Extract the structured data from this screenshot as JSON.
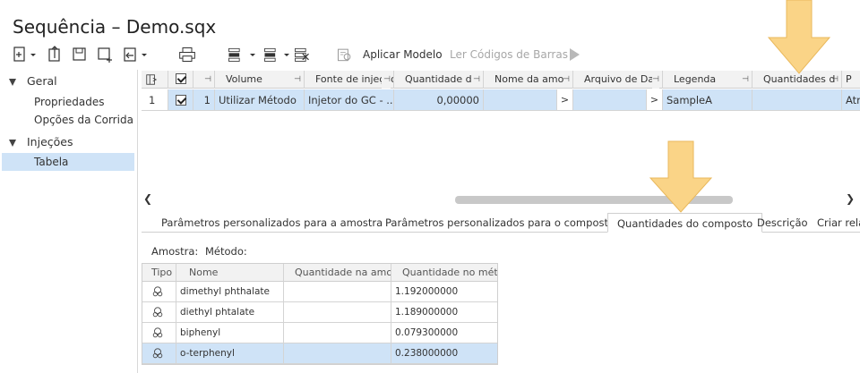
{
  "window": {
    "title": "Sequência – Demo.sqx"
  },
  "toolbar": {
    "apply_model": "Aplicar Modelo",
    "read_barcodes": "Ler Códigos de Barras"
  },
  "nav": {
    "groups": [
      {
        "label": "Geral",
        "items": [
          "Propriedades",
          "Opções da Corrida"
        ]
      },
      {
        "label": "Injeções",
        "items": [
          "Tabela"
        ]
      }
    ]
  },
  "grid": {
    "columns": [
      "",
      "",
      "",
      "Volume",
      "Fonte de injeção",
      "Quantidade d",
      "Nome da amo",
      "Arquivo de Da",
      "Legenda",
      "Quantidades d",
      "P"
    ],
    "row": {
      "index": "1",
      "num": "1",
      "volume": "Utilizar Método",
      "fonte": "Injetor do GC - ...",
      "quantidade": "0,00000",
      "nome_btn": ">",
      "arquivo_btn": ">",
      "legenda": "SampleA",
      "quantidades": "",
      "p": "Atr"
    }
  },
  "tabs": [
    "Parâmetros personalizados para a amostra",
    "Parâmetros personalizados para o composto",
    "Quantidades do composto",
    "Descrição",
    "Criar rela"
  ],
  "compound_panel": {
    "sample_label": "Amostra:",
    "method_label": "Método:",
    "columns": [
      "Tipo",
      "Nome",
      "Quantidade na amo",
      "Quantidade no mét"
    ],
    "rows": [
      {
        "name": "dimethyl phthalate",
        "sample_qty": "",
        "method_qty": "1.192000000"
      },
      {
        "name": "diethyl phtalate",
        "sample_qty": "",
        "method_qty": "1.189000000"
      },
      {
        "name": "biphenyl",
        "sample_qty": "",
        "method_qty": "0.079300000"
      },
      {
        "name": "o-terphenyl",
        "sample_qty": "",
        "method_qty": "0.238000000"
      }
    ]
  },
  "colors": {
    "selection": "#cfe3f7",
    "annotation_arrow": "#fad487"
  }
}
